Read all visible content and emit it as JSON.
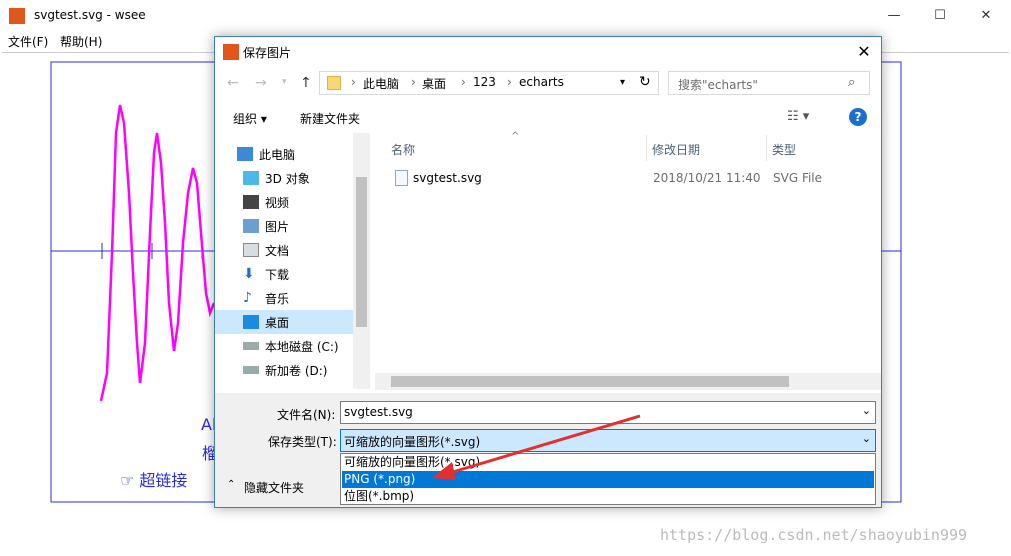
{
  "app": {
    "title": "svgtest.svg - wsee",
    "menu": [
      "文件(F)",
      "帮助(H)"
    ],
    "window_controls": {
      "minimize": "—",
      "maximize": "☐",
      "close": "✕"
    }
  },
  "canvas": {
    "svg_texts": [
      "Al",
      "榴",
      "☞ 超链接"
    ],
    "line_color": "#ff00ff",
    "axis_color": "#2b2bdc"
  },
  "dialog": {
    "title": "保存图片",
    "close": "✕",
    "breadcrumb": [
      "此电脑",
      "桌面",
      "123",
      "echarts"
    ],
    "search_placeholder": "搜索\"echarts\"",
    "toolbar": {
      "organize": "组织 ▾",
      "new_folder": "新建文件夹",
      "help": "?"
    },
    "nav_items": [
      {
        "label": "此电脑",
        "icon": "pc-icon"
      },
      {
        "label": "3D 对象",
        "icon": "3d-objects-icon"
      },
      {
        "label": "视频",
        "icon": "video-icon"
      },
      {
        "label": "图片",
        "icon": "pictures-icon"
      },
      {
        "label": "文档",
        "icon": "documents-icon"
      },
      {
        "label": "下载",
        "icon": "download-icon"
      },
      {
        "label": "音乐",
        "icon": "music-icon"
      },
      {
        "label": "桌面",
        "icon": "desktop-icon"
      },
      {
        "label": "本地磁盘 (C:)",
        "icon": "drive-icon"
      },
      {
        "label": "新加卷 (D:)",
        "icon": "drive-icon"
      }
    ],
    "columns": {
      "name": "名称",
      "date": "修改日期",
      "type": "类型"
    },
    "files": [
      {
        "name": "svgtest.svg",
        "date": "2018/10/21 11:40",
        "type": "SVG File"
      }
    ],
    "filename_label": "文件名(N):",
    "filename_value": "svgtest.svg",
    "filetype_label": "保存类型(T):",
    "filetype_value": "可缩放的向量图形(*.svg)",
    "filetype_options": [
      "可缩放的向量图形(*.svg)",
      "PNG (*.png)",
      "位图(*.bmp)"
    ],
    "selected_option_index": 1,
    "hide_folders": "隐藏文件夹"
  },
  "watermark": "https://blog.csdn.net/shaoyubin999",
  "colors": {
    "accent": "#0078d7",
    "selection": "#cce8ff",
    "arrow": "#e03030"
  }
}
